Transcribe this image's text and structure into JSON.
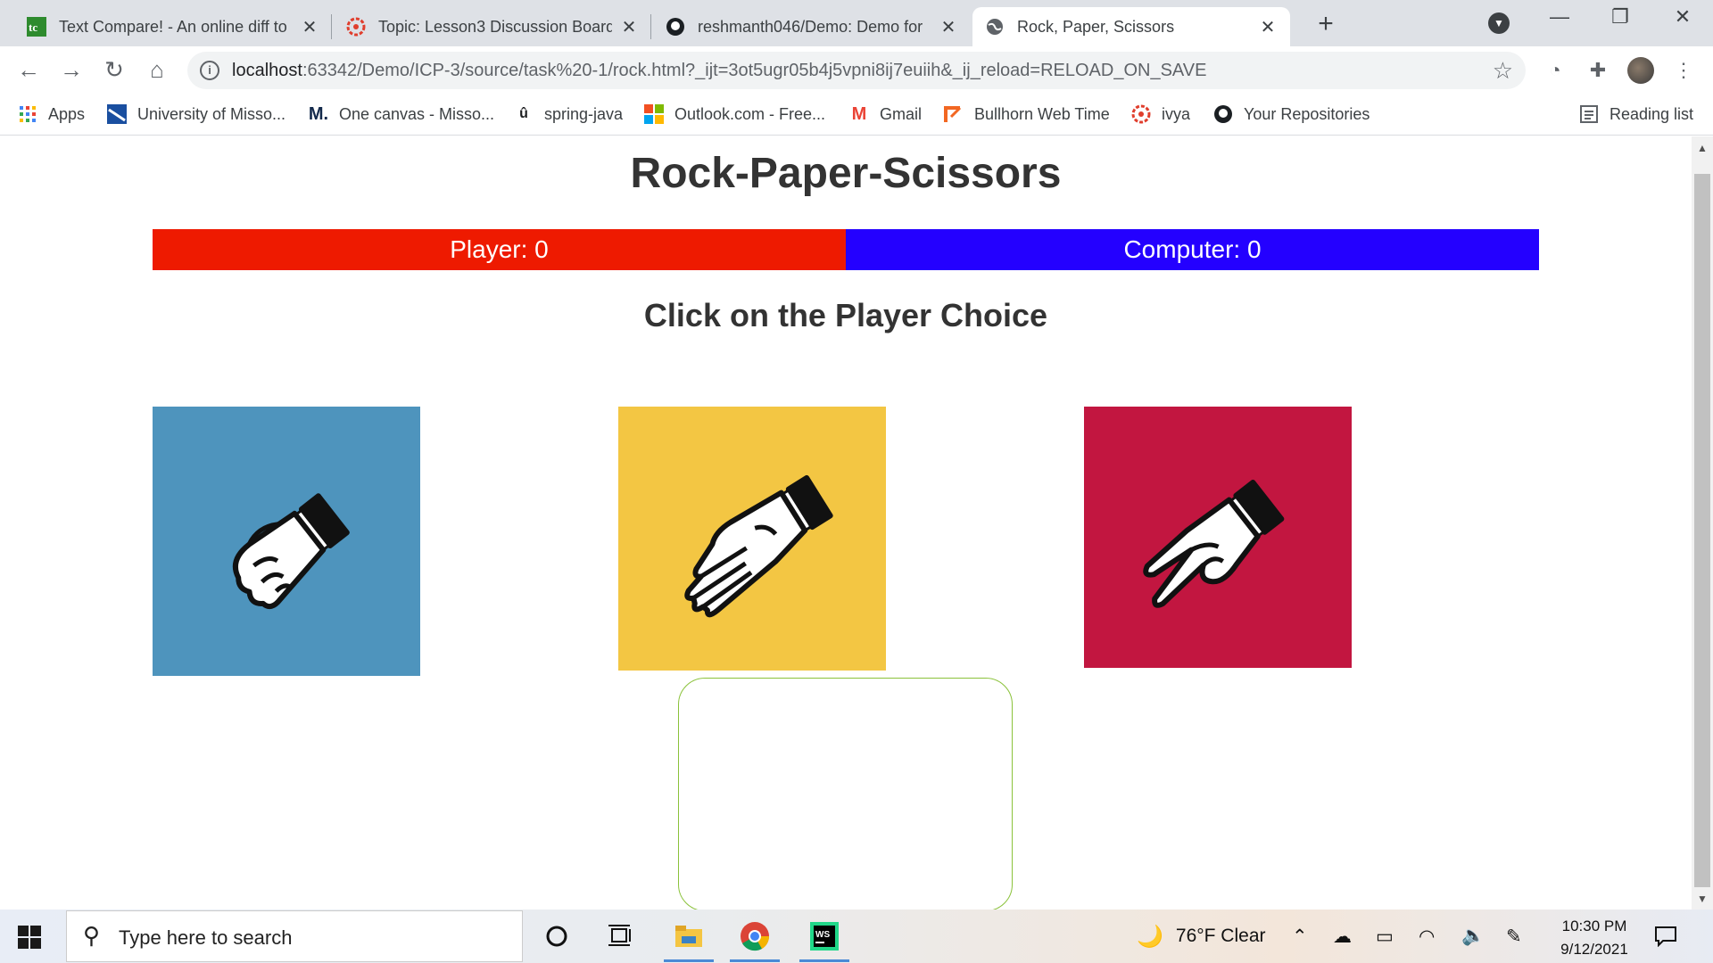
{
  "browser": {
    "tabs": [
      {
        "title": "Text Compare! - An online diff to",
        "icon": "text-compare-icon",
        "active": false
      },
      {
        "title": "Topic: Lesson3 Discussion Board",
        "icon": "canvas-icon",
        "active": false
      },
      {
        "title": "reshmanth046/Demo: Demo for",
        "icon": "github-icon",
        "active": false
      },
      {
        "title": "Rock, Paper, Scissors",
        "icon": "globe-icon",
        "active": true
      }
    ],
    "address": {
      "host": "localhost",
      "path": ":63342/Demo/ICP-3/source/task%20-1/rock.html?_ijt=3ot5ugr05b4j5vpni8ij7euiih&_ij_reload=RELOAD_ON_SAVE"
    },
    "bookmarks": [
      {
        "label": "Apps",
        "icon": "apps-grid-icon"
      },
      {
        "label": "University of Misso...",
        "icon": "university-icon"
      },
      {
        "label": "One canvas - Misso...",
        "icon": "mizzou-icon"
      },
      {
        "label": "spring-java",
        "icon": "udemy-icon"
      },
      {
        "label": "Outlook.com - Free...",
        "icon": "microsoft-icon"
      },
      {
        "label": "Gmail",
        "icon": "gmail-icon"
      },
      {
        "label": "Bullhorn Web Time",
        "icon": "bullhorn-icon"
      },
      {
        "label": "ivya",
        "icon": "canvas-icon"
      },
      {
        "label": "Your Repositories",
        "icon": "github-icon"
      }
    ],
    "reading_list": "Reading list"
  },
  "game": {
    "title": "Rock-Paper-Scissors",
    "player_score": "Player: 0",
    "computer_score": "Computer: 0",
    "instruction": "Click on the Player Choice",
    "choices": [
      {
        "name": "rock",
        "color": "#4e94bd"
      },
      {
        "name": "paper",
        "color": "#f3c643"
      },
      {
        "name": "scissors",
        "color": "#c21640"
      }
    ],
    "player_color": "#ee1a00",
    "computer_color": "#2400ff",
    "result_border_color": "#8ac23a"
  },
  "taskbar": {
    "search_placeholder": "Type here to search",
    "weather": "76°F  Clear",
    "time": "10:30 PM",
    "date": "9/12/2021"
  }
}
